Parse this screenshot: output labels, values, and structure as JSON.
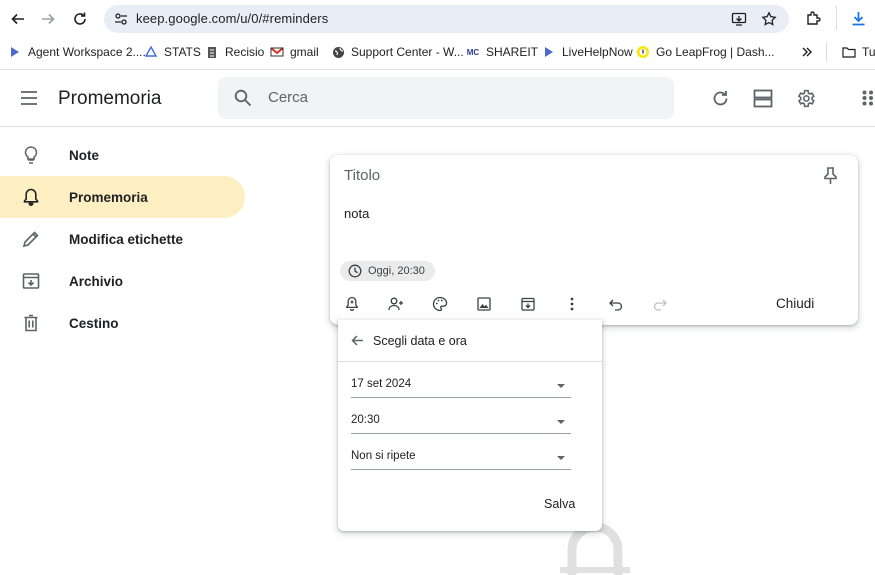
{
  "browser": {
    "url": "keep.google.com/u/0/#reminders",
    "bookmarks": [
      {
        "label": "Agent Workspace 2....",
        "icon": "arrow-bookmark-icon"
      },
      {
        "label": "STATS",
        "icon": "triangle-bookmark-icon"
      },
      {
        "label": "Recisio",
        "icon": "doc-bookmark-icon"
      },
      {
        "label": "gmail",
        "icon": "gmail-bookmark-icon"
      },
      {
        "label": "Support Center - W...",
        "icon": "globe-bookmark-icon"
      },
      {
        "label": "SHAREIT",
        "icon": "mc-bookmark-icon"
      },
      {
        "label": "LiveHelpNow",
        "icon": "arrow-bookmark-icon"
      },
      {
        "label": "Go LeapFrog | Dash...",
        "icon": "leapfrog-bookmark-icon"
      }
    ],
    "overflow_folder": "Tu"
  },
  "header": {
    "app_title": "Promemoria",
    "search_placeholder": "Cerca"
  },
  "sidebar": {
    "items": [
      {
        "label": "Note",
        "icon": "lightbulb-icon",
        "active": false
      },
      {
        "label": "Promemoria",
        "icon": "bell-icon",
        "active": true
      },
      {
        "label": "Modifica etichette",
        "icon": "pencil-icon",
        "active": false
      },
      {
        "label": "Archivio",
        "icon": "archive-icon",
        "active": false
      },
      {
        "label": "Cestino",
        "icon": "trash-icon",
        "active": false
      }
    ]
  },
  "note": {
    "title_placeholder": "Titolo",
    "body": "nota",
    "reminder_chip": "Oggi, 20:30",
    "close_label": "Chiudi"
  },
  "picker": {
    "title": "Scegli data e ora",
    "date": "17 set 2024",
    "time": "20:30",
    "repeat": "Non si ripete",
    "save_label": "Salva"
  },
  "colors": {
    "active_bg": "#feefc3",
    "search_bg": "#f1f3f4",
    "omnibox_bg": "#e9eef6",
    "download_icon": "#1a73e8"
  }
}
